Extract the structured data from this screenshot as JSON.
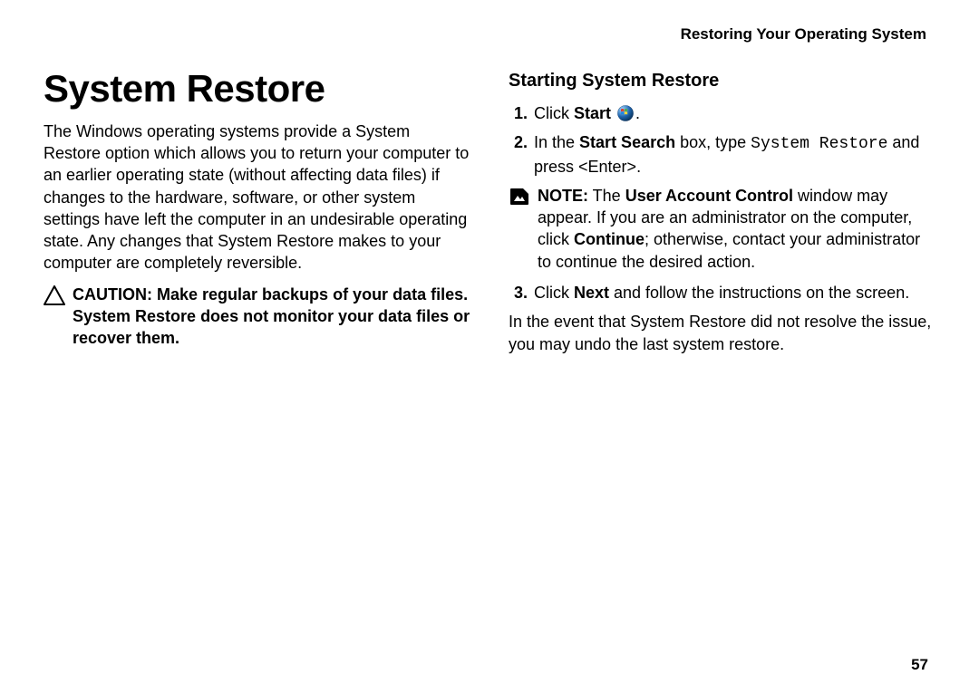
{
  "runningHeader": "Restoring Your Operating System",
  "pageNumber": "57",
  "left": {
    "title": "System Restore",
    "intro": "The Windows operating systems provide a System Restore option which allows you to return your computer to an earlier operating state (without affecting data files) if changes to the hardware, software, or other system settings have left the computer in an undesirable operating state. Any changes that System Restore makes to your computer are completely reversible.",
    "caution": "CAUTION: Make regular backups of your data files. System Restore does not monitor your data files or recover them."
  },
  "right": {
    "subtitle": "Starting System Restore",
    "step1_pre": "Click ",
    "step1_bold": "Start",
    "step1_post": " ",
    "step1_end": ".",
    "step2_pre": "In the ",
    "step2_bold": "Start Search",
    "step2_mid": " box, type ",
    "step2_code": "System Restore",
    "step2_post": " and press <Enter>.",
    "note_label": "NOTE:",
    "note_pre": " The ",
    "note_bold1": "User Account Control",
    "note_mid1": " window may appear. If you are an administrator on the computer, click ",
    "note_bold2": "Continue",
    "note_post": "; otherwise, contact your administrator to continue the desired action.",
    "step3_pre": "Click ",
    "step3_bold": "Next",
    "step3_post": " and follow the instructions on the screen.",
    "closing": "In the event that System Restore did not resolve the issue, you may undo the last system restore."
  }
}
